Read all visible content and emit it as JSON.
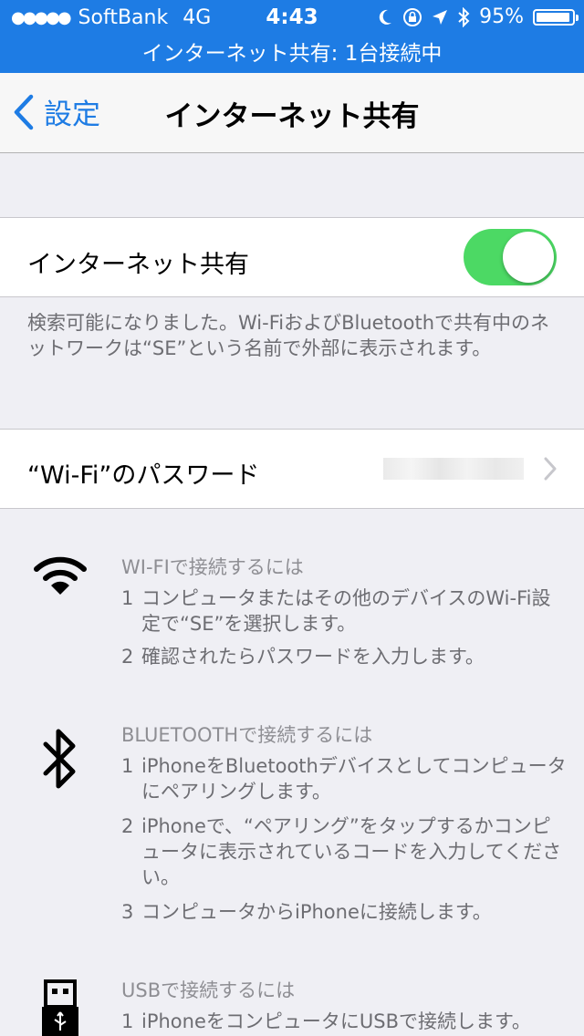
{
  "status": {
    "carrier": "SoftBank",
    "network": "4G",
    "time": "4:43",
    "battery": "95%",
    "battery_level": 0.95
  },
  "hotspot_banner": "インターネット共有: 1台接続中",
  "nav": {
    "back_label": "設定",
    "title": "インターネット共有"
  },
  "sharing": {
    "label": "インターネット共有",
    "enabled": true,
    "note": "検索可能になりました。Wi-FiおよびBluetoothで共有中のネットワークは“SE”という名前で外部に表示されます。"
  },
  "wifi_password": {
    "label": "“Wi-Fi”のパスワード"
  },
  "instructions": {
    "wifi": {
      "title": "WI-FIで接続するには",
      "steps": [
        {
          "num": "1",
          "text": "コンピュータまたはその他のデバイスのWi-Fi設定で“SE”を選択します。"
        },
        {
          "num": "2",
          "text": "確認されたらパスワードを入力します。"
        }
      ]
    },
    "bluetooth": {
      "title": "BLUETOOTHで接続するには",
      "steps": [
        {
          "num": "1",
          "text": "iPhoneをBluetoothデバイスとしてコンピュータにペアリングします。"
        },
        {
          "num": "2",
          "text": "iPhoneで、“ペアリング”をタップするかコンピュータに表示されているコードを入力してください。"
        },
        {
          "num": "3",
          "text": "コンピュータからiPhoneに接続します。"
        }
      ]
    },
    "usb": {
      "title": "USBで接続するには",
      "steps": [
        {
          "num": "1",
          "text": "iPhoneをコンピュータにUSBで接続します。"
        }
      ]
    }
  },
  "colors": {
    "accent": "#1e7ce4",
    "toggle_on": "#4cd964",
    "background": "#efeff4",
    "secondary_text": "#6d6d72"
  }
}
